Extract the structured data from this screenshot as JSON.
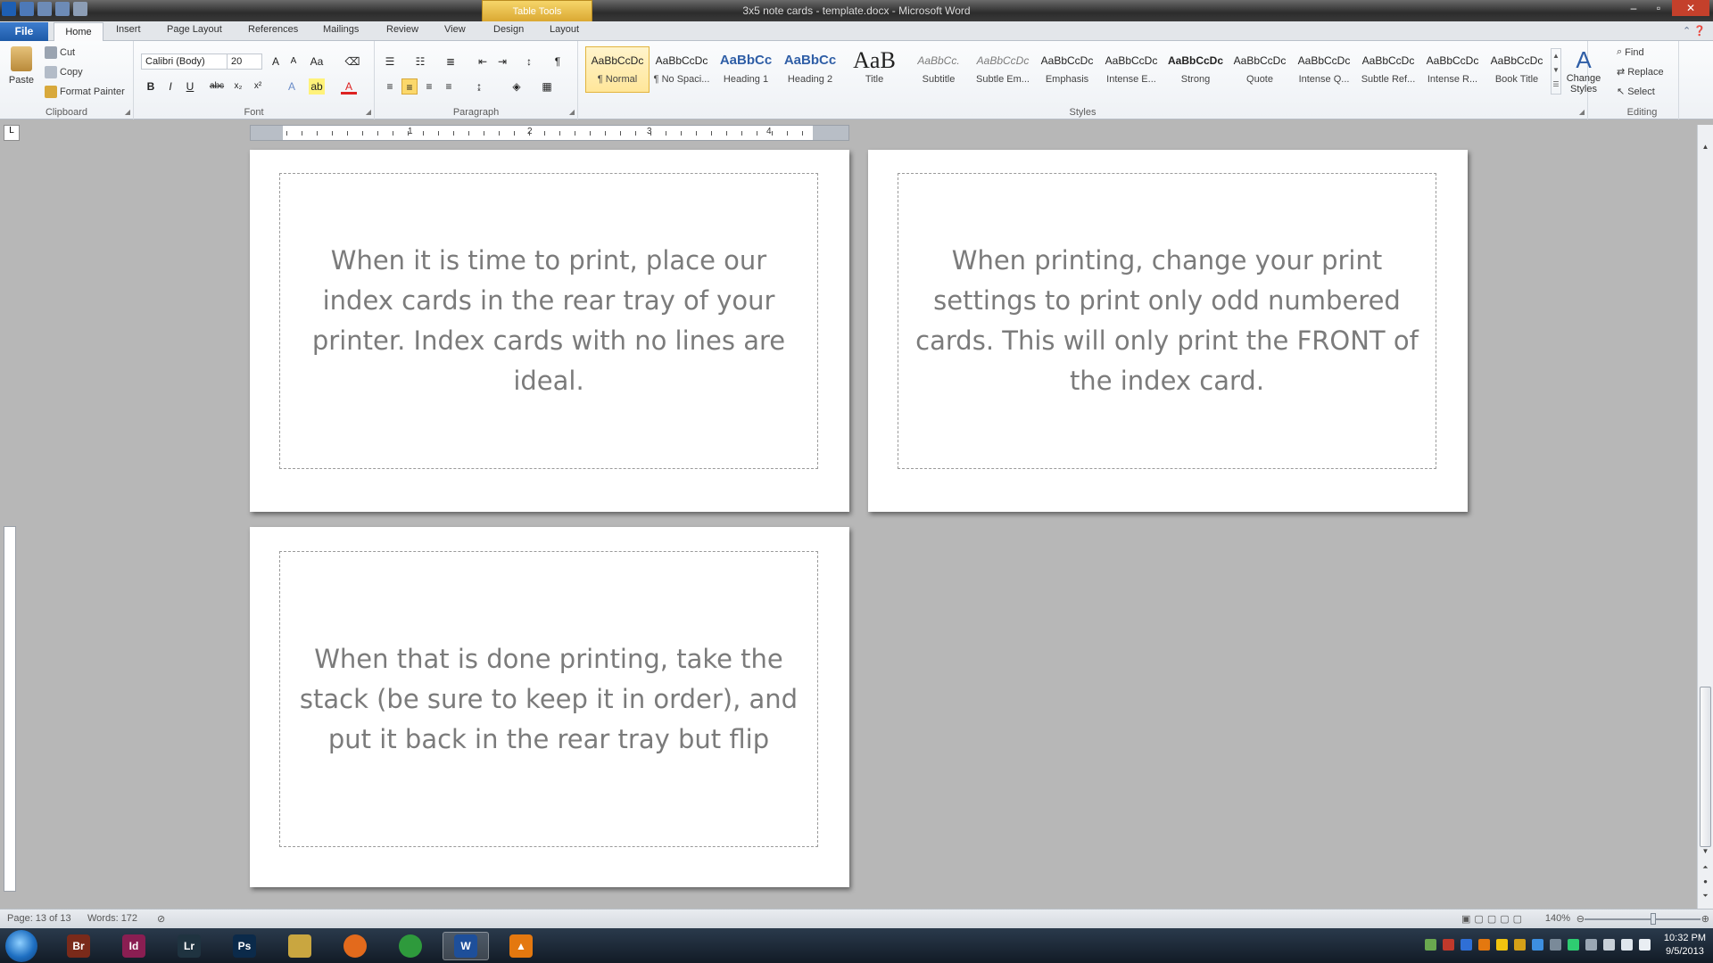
{
  "window": {
    "title": "3x5 note cards - template.docx - Microsoft Word",
    "context_tab": "Table Tools"
  },
  "tabs": [
    "File",
    "Home",
    "Insert",
    "Page Layout",
    "References",
    "Mailings",
    "Review",
    "View",
    "Design",
    "Layout"
  ],
  "ribbon": {
    "clipboard": {
      "label": "Clipboard",
      "paste": "Paste",
      "cut": "Cut",
      "copy": "Copy",
      "format_painter": "Format Painter"
    },
    "font": {
      "label": "Font",
      "font_name": "Calibri (Body)",
      "font_size": "20",
      "bold": "B",
      "italic": "I",
      "underline": "U"
    },
    "paragraph": {
      "label": "Paragraph"
    },
    "styles": {
      "label": "Styles",
      "items": [
        {
          "sample": "AaBbCcDc",
          "name": "¶ Normal"
        },
        {
          "sample": "AaBbCcDc",
          "name": "¶ No Spaci..."
        },
        {
          "sample": "AaBbCc",
          "name": "Heading 1"
        },
        {
          "sample": "AaBbCc",
          "name": "Heading 2"
        },
        {
          "sample": "AaB",
          "name": "Title"
        },
        {
          "sample": "AaBbCc.",
          "name": "Subtitle"
        },
        {
          "sample": "AaBbCcDc",
          "name": "Subtle Em..."
        },
        {
          "sample": "AaBbCcDc",
          "name": "Emphasis"
        },
        {
          "sample": "AaBbCcDc",
          "name": "Intense E..."
        },
        {
          "sample": "AaBbCcDc",
          "name": "Strong"
        },
        {
          "sample": "AaBbCcDc",
          "name": "Quote"
        },
        {
          "sample": "AaBbCcDc",
          "name": "Intense Q..."
        },
        {
          "sample": "AaBbCcDc",
          "name": "Subtle Ref..."
        },
        {
          "sample": "AaBbCcDc",
          "name": "Intense R..."
        },
        {
          "sample": "AaBbCcDc",
          "name": "Book Title"
        }
      ],
      "change_styles": "Change Styles"
    },
    "editing": {
      "label": "Editing",
      "find": "Find",
      "replace": "Replace",
      "select": "Select"
    }
  },
  "ruler": {
    "numbers": [
      "1",
      "2",
      "3",
      "4"
    ]
  },
  "cards": [
    "When it is time to print, place our index cards in the rear tray of your printer.  Index cards with no lines are ideal.",
    "When printing, change your print settings to print only odd numbered cards.  This will only print the FRONT of the index card.",
    "When that is done printing, take the stack (be sure to keep it in order), and put it back in the rear tray but flip"
  ],
  "status": {
    "page": "Page: 13 of 13",
    "words": "Words: 172",
    "zoom": "140%"
  },
  "taskbar": {
    "apps": [
      {
        "icon": "bridge-icon",
        "glyph": "Br",
        "color": "#7a2a1a"
      },
      {
        "icon": "indesign-icon",
        "glyph": "Id",
        "color": "#8a1e52"
      },
      {
        "icon": "lightroom-icon",
        "glyph": "Lr",
        "color": "#1f3340"
      },
      {
        "icon": "photoshop-icon",
        "glyph": "Ps",
        "color": "#0b2a4a"
      },
      {
        "icon": "explorer-icon",
        "glyph": "",
        "color": "#c9a640"
      },
      {
        "icon": "firefox-icon",
        "glyph": "",
        "color": "#e36a1c"
      },
      {
        "icon": "chrome-icon",
        "glyph": "",
        "color": "#2e9a3c"
      },
      {
        "icon": "word-icon",
        "glyph": "W",
        "color": "#1e4f9a"
      },
      {
        "icon": "vlc-icon",
        "glyph": "▲",
        "color": "#e4780f"
      }
    ],
    "time": "10:32 PM",
    "date": "9/5/2013"
  }
}
